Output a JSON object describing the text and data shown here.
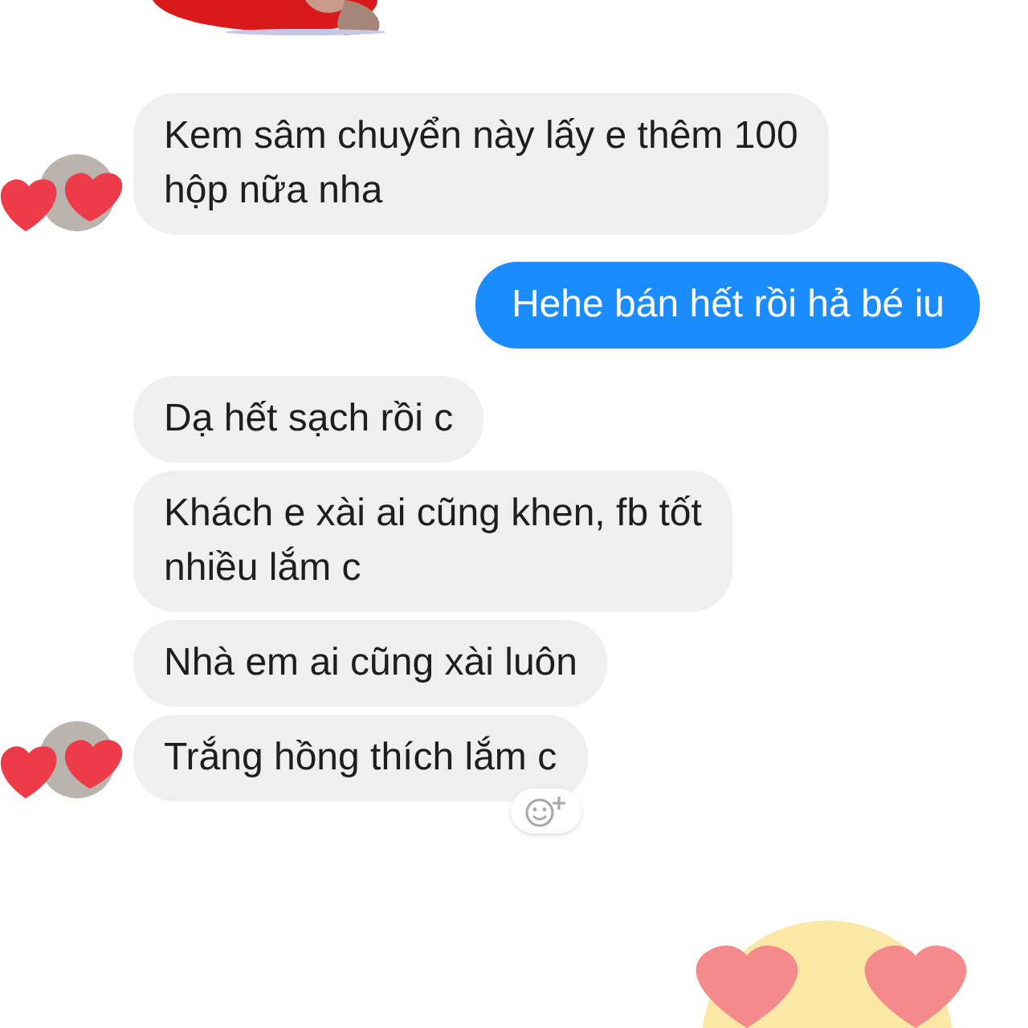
{
  "messages": [
    {
      "kind": "received",
      "text": "Kem sâm chuyển này lấy e thêm 100\nhộp nữa nha",
      "avatar": true,
      "reaction_button": false
    },
    {
      "kind": "sent",
      "text": "Hehe bán hết rồi hả bé iu",
      "avatar": false,
      "reaction_button": false
    },
    {
      "kind": "received",
      "text": "Dạ hết sạch rồi c",
      "avatar": false,
      "reaction_button": false
    },
    {
      "kind": "received",
      "text": "Khách e xài ai cũng khen, fb tốt\nnhiều lắm c",
      "avatar": false,
      "reaction_button": false
    },
    {
      "kind": "received",
      "text": "Nhà em ai cũng xài luôn",
      "avatar": false,
      "reaction_button": false
    },
    {
      "kind": "received",
      "text": "Trắng hồng thích lắm c",
      "avatar": true,
      "reaction_button": true
    }
  ]
}
